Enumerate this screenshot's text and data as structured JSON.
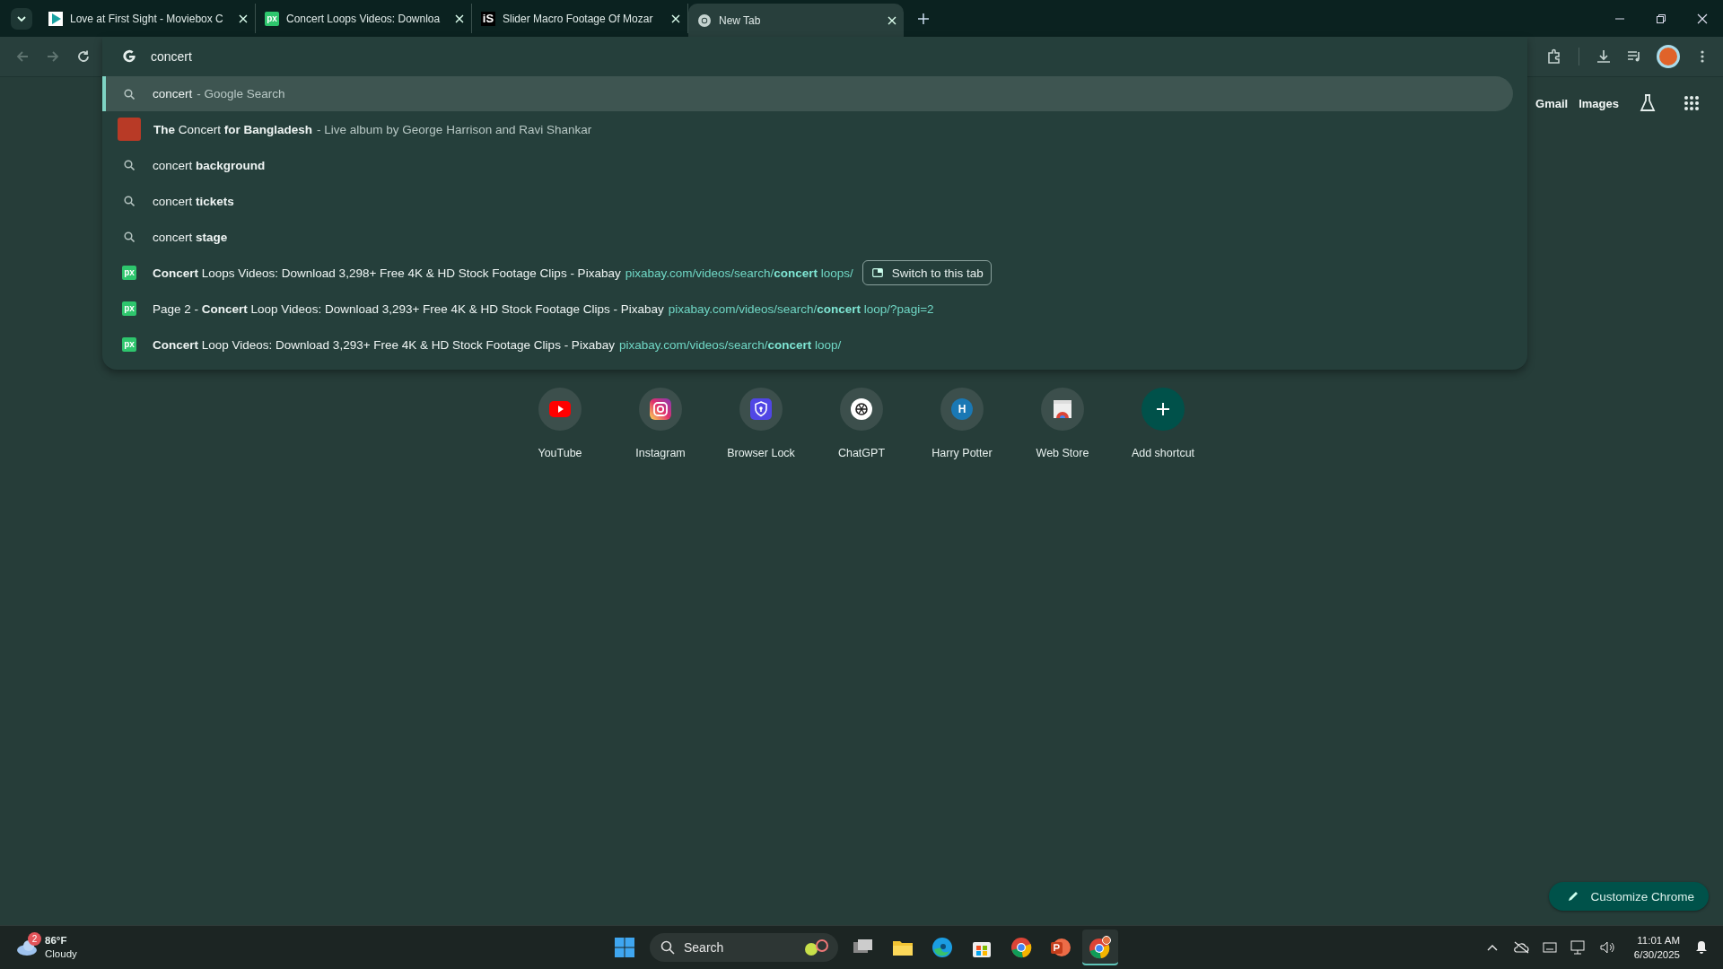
{
  "tabs": [
    {
      "title": "Love at First Sight - Moviebox C",
      "selected": false
    },
    {
      "title": "Concert Loops Videos: Downloa",
      "favicon_text": "px",
      "selected": false
    },
    {
      "title": "Slider Macro Footage Of Mozar",
      "favicon_text": "iS",
      "selected": false
    },
    {
      "title": "New Tab",
      "selected": true
    }
  ],
  "omnibox": {
    "value": "concert"
  },
  "suggestions": [
    {
      "kind": "search",
      "text": "concert",
      "detail": "- Google Search",
      "selected": true
    },
    {
      "kind": "entity",
      "text": "**The** Concert **for Bangladesh**",
      "detail": "- Live album by George Harrison and Ravi Shankar",
      "selected": false
    },
    {
      "kind": "search",
      "text": "concert **background**",
      "selected": false
    },
    {
      "kind": "search",
      "text": "concert **tickets**",
      "selected": false
    },
    {
      "kind": "search",
      "text": "concert **stage**",
      "selected": false
    },
    {
      "kind": "history",
      "favicon_text": "px",
      "text": "**Concert** Loops Videos: Download 3,298+ Free 4K & HD Stock Footage Clips - Pixabay",
      "url": "pixabay.com/videos/search/**concert** loops/",
      "action": "Switch to this tab",
      "selected": false
    },
    {
      "kind": "history",
      "favicon_text": "px",
      "text": "Page 2 - **Concert** Loop Videos: Download 3,293+ Free 4K & HD Stock Footage Clips - Pixabay",
      "url": "pixabay.com/videos/search/**concert** loop/?pagi=2",
      "selected": false
    },
    {
      "kind": "history",
      "favicon_text": "px",
      "text": "**Concert** Loop Videos: Download 3,293+ Free 4K & HD Stock Footage Clips - Pixabay",
      "url": "pixabay.com/videos/search/**concert** loop/",
      "selected": false
    }
  ],
  "header_links": [
    "Gmail",
    "Images"
  ],
  "shortcuts": [
    {
      "kind": "site",
      "title": "YouTube"
    },
    {
      "kind": "site",
      "title": "Instagram"
    },
    {
      "kind": "site",
      "title": "Browser Lock"
    },
    {
      "kind": "site",
      "title": "ChatGPT"
    },
    {
      "kind": "site",
      "title": "Harry Potter",
      "letter": "H"
    },
    {
      "kind": "site",
      "title": "Web Store"
    },
    {
      "kind": "add",
      "title": "Add shortcut"
    }
  ],
  "customize_button": "Customize Chrome",
  "taskbar": {
    "weather": {
      "badge": "2",
      "temperature": "86°F",
      "condition": "Cloudy"
    },
    "search_placeholder": "Search",
    "time": "11:01 AM",
    "date": "6/30/2025"
  }
}
